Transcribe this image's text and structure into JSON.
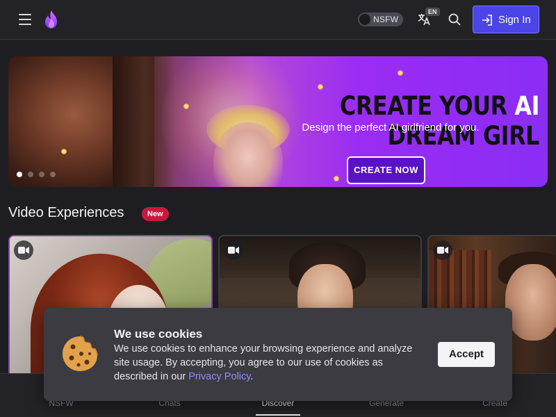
{
  "header": {
    "nsfw_label": "NSFW",
    "lang_badge": "EN",
    "sign_in_label": "Sign In"
  },
  "hero": {
    "title_part1": "CREATE YOUR ",
    "title_ai": "AI",
    "title_part2": " DREAM GIRL",
    "subtitle": "Design the perfect AI girlfriend for you.",
    "cta_label": "CREATE NOW",
    "active_slide": 1,
    "slide_count": 4
  },
  "section": {
    "title": "Video Experiences",
    "badge": "New"
  },
  "cookie": {
    "heading": "We use cookies",
    "body_text": "We use cookies to enhance your browsing experience and analyze site usage. By accepting, you agree to our use of cookies as described in our ",
    "link_text": "Privacy Policy",
    "trailing": ".",
    "accept_label": "Accept"
  },
  "bottom_nav": {
    "items": [
      {
        "label": "NSFW"
      },
      {
        "label": "Chats"
      },
      {
        "label": "Discover"
      },
      {
        "label": "Generate"
      },
      {
        "label": "Create"
      }
    ],
    "active": "Discover"
  },
  "colors": {
    "accent": "#4b44e6",
    "badge_red": "#c9183e",
    "hero_purple": "#8a2df5",
    "link": "#8f8cff"
  },
  "icons": {
    "menu": "hamburger-icon",
    "logo": "flame-logo",
    "translate": "translate-icon",
    "search": "search-icon",
    "sign_in": "login-icon",
    "video": "video-camera-icon",
    "cookie": "cookie-icon"
  }
}
